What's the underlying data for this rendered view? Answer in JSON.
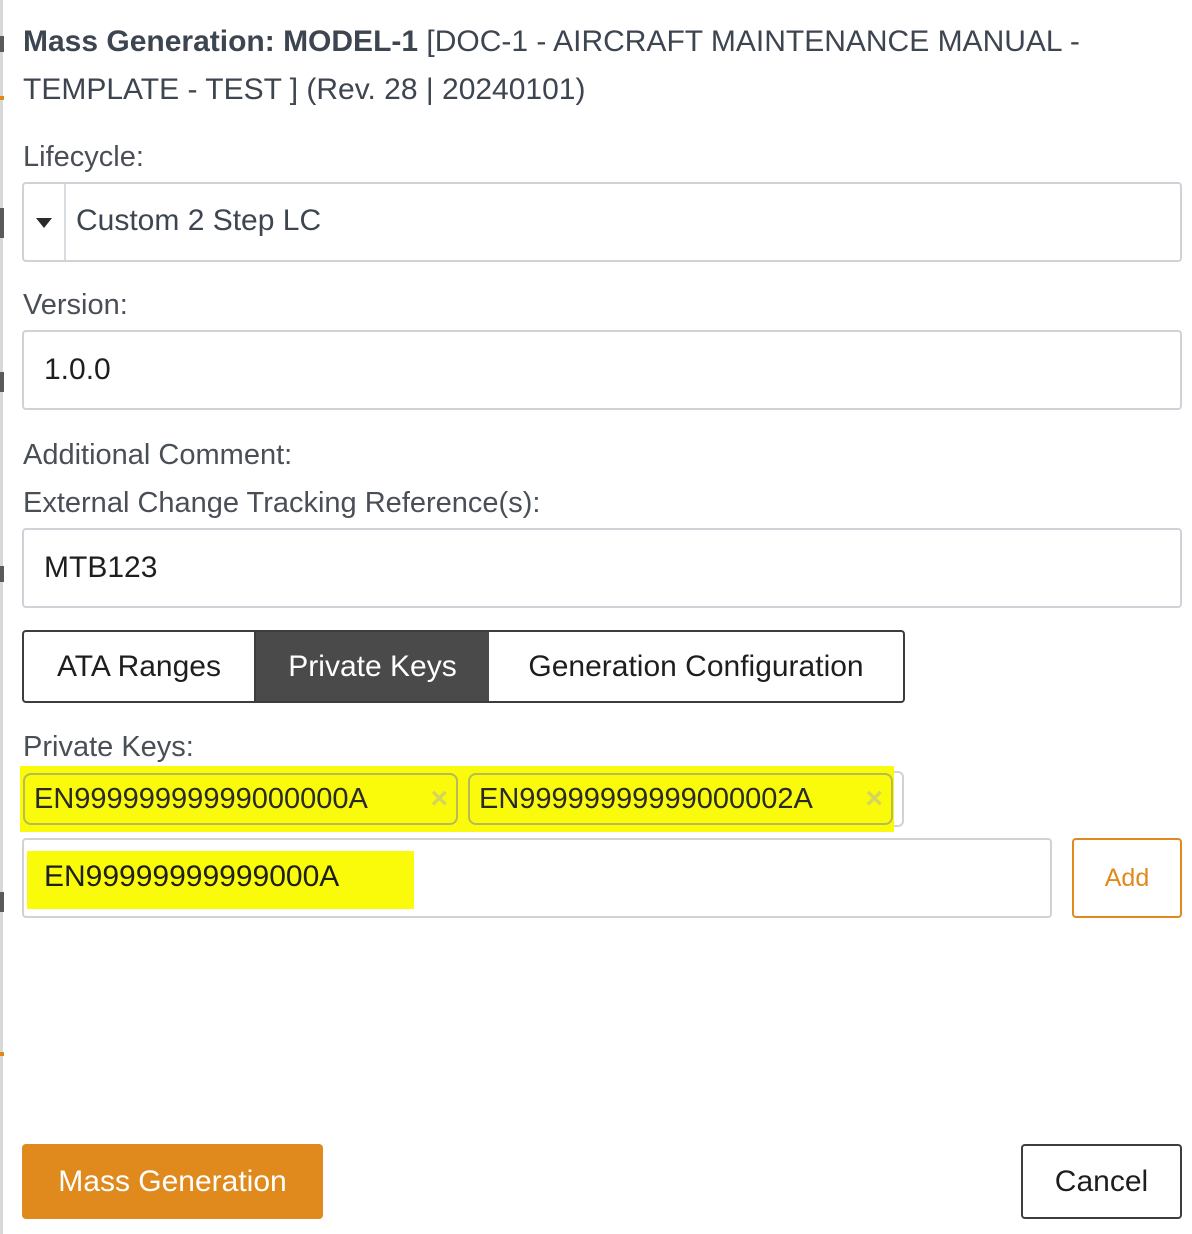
{
  "dialog": {
    "title_bold": "Mass Generation: MODEL-1",
    "title_rest": " [DOC-1 - AIRCRAFT MAINTENANCE MANUAL - TEMPLATE - TEST ] (Rev. 28 | 20240101)"
  },
  "lifecycle": {
    "label": "Lifecycle:",
    "value": "Custom 2 Step LC"
  },
  "version": {
    "label": "Version:",
    "value": "1.0.0"
  },
  "comment": {
    "label": "Additional Comment:"
  },
  "tracking": {
    "label": "External Change Tracking Reference(s):",
    "value": "MTB123"
  },
  "tabs": [
    {
      "label": "ATA Ranges",
      "active": false
    },
    {
      "label": "Private Keys",
      "active": true
    },
    {
      "label": "Generation Configuration",
      "active": false
    }
  ],
  "private_keys": {
    "label": "Private Keys:",
    "tags": [
      "EN99999999999000000A",
      "EN99999999999000002A"
    ],
    "remove_glyph": "×",
    "input_value": "EN99999999999000A",
    "add_label": "Add"
  },
  "actions": {
    "submit_label": "Mass Generation",
    "cancel_label": "Cancel"
  },
  "colors": {
    "accent": "#e08a1e",
    "highlight": "#f9fb0b",
    "active_tab": "#4a4a4a"
  },
  "icons": {
    "lifecycle_dropdown": "caret-down-icon",
    "tag_remove": "close-icon"
  }
}
